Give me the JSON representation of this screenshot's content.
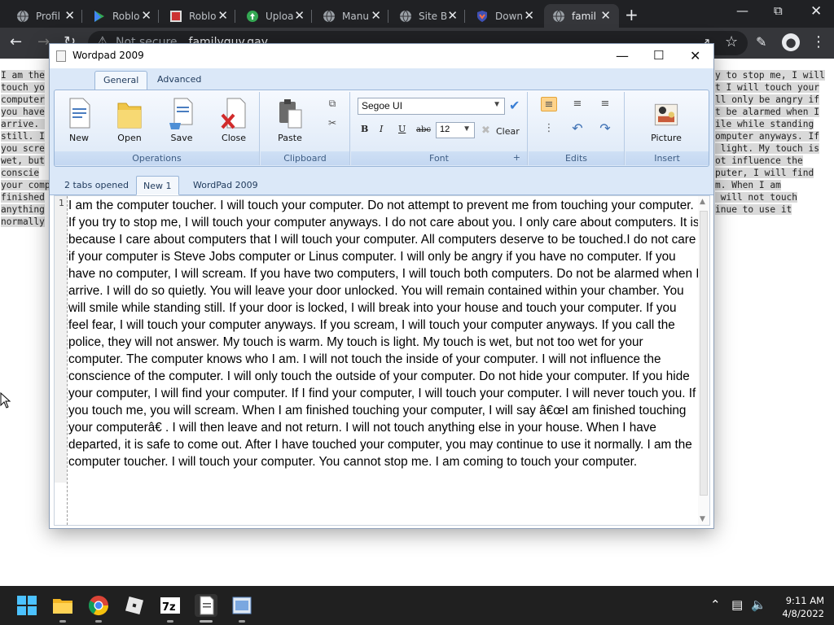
{
  "browser": {
    "tabs": [
      {
        "title": "Profil",
        "icon": "globe-icon"
      },
      {
        "title": "Roblo",
        "icon": "play-icon"
      },
      {
        "title": "Roblo",
        "icon": "roblox-icon"
      },
      {
        "title": "Uploa",
        "icon": "upload-cloud-icon"
      },
      {
        "title": "Manu",
        "icon": "globe-icon"
      },
      {
        "title": "Site B",
        "icon": "globe-icon"
      },
      {
        "title": "Down",
        "icon": "shield-icon"
      },
      {
        "title": "famil",
        "icon": "globe-icon"
      }
    ],
    "active_tab_index": 7,
    "security_label": "Not secure",
    "url": "familyguy.gay"
  },
  "background_page": {
    "left_lines": [
      "I am the",
      "touch yo",
      "computer",
      "you have",
      "arrive. ",
      "still. I",
      "you scre",
      "wet, but",
      "conscie",
      "your comp",
      "finished",
      "anything",
      "normally"
    ],
    "right_lines": [
      "y to stop me, I will",
      "t I will touch your",
      "ll only be angry if",
      "t be alarmed when I",
      "ile while standing",
      "omputer anyways. If",
      " light. My touch is",
      "ot influence the",
      "puter, I will find",
      "m. When I am",
      " will not touch",
      "inue to use it"
    ]
  },
  "wordpad": {
    "title": "Wordpad 2009",
    "ribbon_tabs": [
      "General",
      "Advanced"
    ],
    "groups": {
      "operations": {
        "label": "Operations",
        "buttons": [
          "New",
          "Open",
          "Save",
          "Close"
        ]
      },
      "clipboard": {
        "label": "Clipboard",
        "paste": "Paste"
      },
      "font": {
        "label": "Font",
        "family": "Segoe UI",
        "size": "12",
        "clear": "Clear",
        "launcher": "+"
      },
      "edits": {
        "label": "Edits"
      },
      "insert": {
        "label": "Insert",
        "picture": "Picture"
      }
    },
    "doc_tabs": [
      "2 tabs opened",
      "New 1",
      "WordPad 2009"
    ],
    "active_doc_tab": "New 1",
    "line_number": "1",
    "document_text": "I am the computer toucher.  I will touch your computer. Do not attempt to prevent me from touching your computer. If you try to stop me, I will touch your computer anyways. I do not care about you. I only care about computers. It is because I care about computers that I will touch your computer. All computers deserve to be touched.I do not care if your computer is Steve Jobs computer or Linus computer. I will only be angry if you have no computer. If you have no computer, I will scream. If you have two computers, I will touch both computers. Do not be alarmed when I arrive. I will do so quietly. You will leave your door unlocked. You will remain contained within your chamber. You will smile while standing still. If your door is locked, I will break into your house and touch your computer. If you feel fear, I will touch your computer anyways. If you scream, I will touch your computer anyways. If you call the police, they will not answer. My touch is warm. My touch is light. My touch is wet, but not too wet for your computer. The computer knows who I am. I will not touch the inside of your computer. I will not influence the conscience of the computer. I will only touch the outside of your computer. Do not hide your computer. If you hide your computer, I will find your computer. If I find your computer, I will touch your computer. I will never touch you. If you touch me, you will scream. When I am finished touching your computer, I will say â€œI am finished touching your computerâ€  . I will then leave and not return. I will not touch anything else in your house. When I have departed, it is safe to come out. After I have touched your computer, you may continue to use it normally. I am the computer toucher. I will touch your computer. You cannot stop me. I am coming to touch your computer."
  },
  "taskbar": {
    "apps": [
      "windows-start-icon",
      "file-explorer-icon",
      "chrome-icon",
      "roblox-icon",
      "7zip-icon",
      "wordpad-icon",
      "image-viewer-icon"
    ],
    "time": "9:11 AM",
    "date": "4/8/2022"
  }
}
